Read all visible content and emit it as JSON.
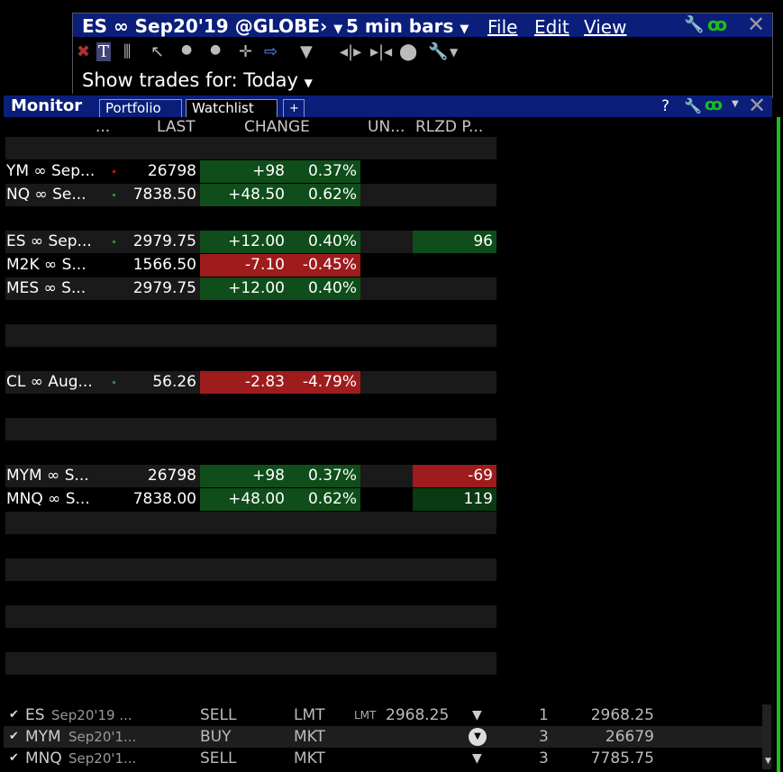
{
  "chart_window": {
    "symbol": "ES ∞ Sep20'19 @GLOBE›",
    "bar_size": "5 min bars",
    "menus": [
      "File",
      "Edit",
      "View"
    ],
    "trades_label": "Show trades for:",
    "trades_value": "Today"
  },
  "monitor": {
    "title": "Monitor",
    "tabs": [
      "Portfolio",
      "Watchlist",
      "+"
    ],
    "help": "?",
    "columns": [
      "...",
      "LAST",
      "CHANGE",
      "UN...",
      "RLZD P..."
    ],
    "rows": [
      {
        "symbol": "",
        "last": "",
        "change": "",
        "pct": "",
        "rlzd": "",
        "trend": ""
      },
      {
        "symbol": "YM ∞ Sep...",
        "last": "26798",
        "change": "+98",
        "pct": "0.37%",
        "rlzd": "",
        "trend": "up",
        "dot": "#cc1111"
      },
      {
        "symbol": "NQ ∞ Se...",
        "last": "7838.50",
        "change": "+48.50",
        "pct": "0.62%",
        "rlzd": "",
        "trend": "up",
        "dot": "#338833"
      },
      {
        "symbol": "",
        "last": "",
        "change": "",
        "pct": "",
        "rlzd": "",
        "trend": ""
      },
      {
        "symbol": "ES ∞ Sep...",
        "last": "2979.75",
        "change": "+12.00",
        "pct": "0.40%",
        "rlzd": "96",
        "trend": "up",
        "dot": "#338833",
        "rlzd_bg": "green"
      },
      {
        "symbol": "M2K ∞ S...",
        "last": "1566.50",
        "change": "-7.10",
        "pct": "-0.45%",
        "rlzd": "",
        "trend": "down"
      },
      {
        "symbol": "MES ∞ S...",
        "last": "2979.75",
        "change": "+12.00",
        "pct": "0.40%",
        "rlzd": "",
        "trend": "up"
      },
      {
        "symbol": "",
        "last": "",
        "change": "",
        "pct": "",
        "rlzd": "",
        "trend": ""
      },
      {
        "symbol": "",
        "last": "",
        "change": "",
        "pct": "",
        "rlzd": "",
        "trend": ""
      },
      {
        "symbol": "",
        "last": "",
        "change": "",
        "pct": "",
        "rlzd": "",
        "trend": ""
      },
      {
        "symbol": "CL ∞ Aug...",
        "last": "56.26",
        "change": "-2.83",
        "pct": "-4.79%",
        "rlzd": "",
        "trend": "down",
        "dot": "#338833"
      },
      {
        "symbol": "",
        "last": "",
        "change": "",
        "pct": "",
        "rlzd": "",
        "trend": ""
      },
      {
        "symbol": "",
        "last": "",
        "change": "",
        "pct": "",
        "rlzd": "",
        "trend": ""
      },
      {
        "symbol": "",
        "last": "",
        "change": "",
        "pct": "",
        "rlzd": "",
        "trend": ""
      },
      {
        "symbol": "MYM ∞ S...",
        "last": "26798",
        "change": "+98",
        "pct": "0.37%",
        "rlzd": "-69",
        "trend": "up",
        "rlzd_bg": "red"
      },
      {
        "symbol": "MNQ ∞ S...",
        "last": "7838.00",
        "change": "+48.00",
        "pct": "0.62%",
        "rlzd": "119",
        "trend": "up",
        "rlzd_bg": "dkgreen"
      },
      {
        "symbol": "",
        "last": "",
        "change": "",
        "pct": "",
        "rlzd": "",
        "trend": ""
      },
      {
        "symbol": "",
        "last": "",
        "change": "",
        "pct": "",
        "rlzd": "",
        "trend": ""
      },
      {
        "symbol": "",
        "last": "",
        "change": "",
        "pct": "",
        "rlzd": "",
        "trend": ""
      },
      {
        "symbol": "",
        "last": "",
        "change": "",
        "pct": "",
        "rlzd": "",
        "trend": ""
      },
      {
        "symbol": "",
        "last": "",
        "change": "",
        "pct": "",
        "rlzd": "",
        "trend": ""
      },
      {
        "symbol": "",
        "last": "",
        "change": "",
        "pct": "",
        "rlzd": "",
        "trend": ""
      },
      {
        "symbol": "",
        "last": "",
        "change": "",
        "pct": "",
        "rlzd": "",
        "trend": ""
      },
      {
        "symbol": "",
        "last": "",
        "change": "",
        "pct": "",
        "rlzd": "",
        "trend": ""
      }
    ]
  },
  "orders": [
    {
      "sym": "ES",
      "contract": "Sep20'19 ...",
      "action": "SELL",
      "type": "MKT_LMT",
      "type_label": "LMT",
      "lmt_tag": "LMT",
      "price": "2968.25",
      "qty": "1",
      "value": "2968.25"
    },
    {
      "sym": "MYM",
      "contract": "Sep20'1...",
      "action": "BUY",
      "type_label": "MKT",
      "lmt_tag": "",
      "price": "",
      "qty": "3",
      "value": "26679"
    },
    {
      "sym": "MNQ",
      "contract": "Sep20'1...",
      "action": "SELL",
      "type_label": "MKT",
      "lmt_tag": "",
      "price": "",
      "qty": "3",
      "value": "7785.75"
    }
  ],
  "colors": {
    "title_bar": "#0a1e7a",
    "up": "#0f4d1a",
    "down": "#9e1c1c",
    "link_green": "#19c119"
  }
}
